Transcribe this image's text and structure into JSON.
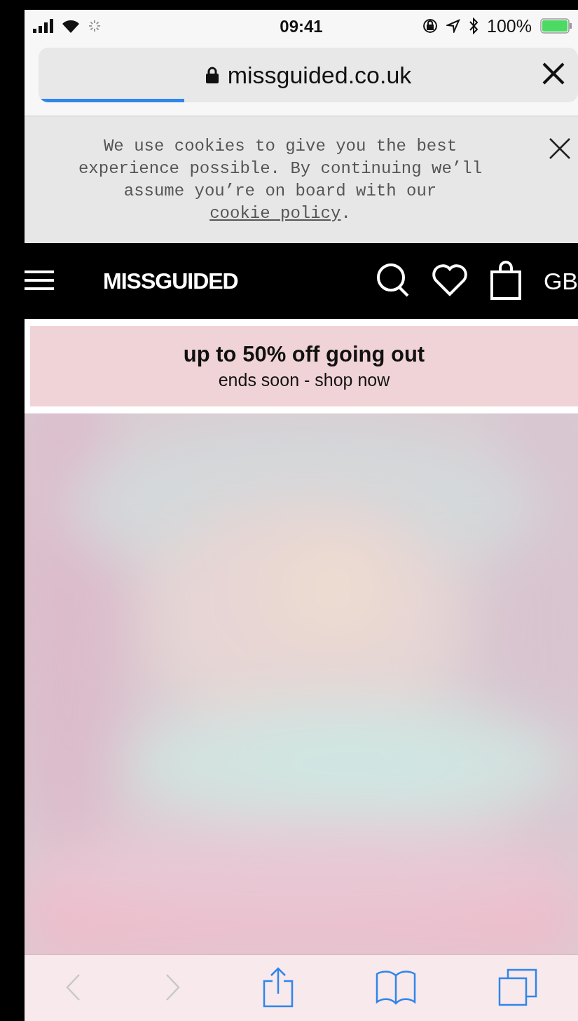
{
  "status_bar": {
    "time": "09:41",
    "battery": "100%"
  },
  "address_bar": {
    "url": "missguided.co.uk",
    "level": 0.27
  },
  "cookie_banner": {
    "text": "We use cookies to give you the best experience possible. By continuing we’ll assume you’re on board with our ",
    "link": "cookie policy",
    "end": "."
  },
  "site_header": {
    "logo": "MISSGUIDED",
    "region": "GB"
  },
  "promo": {
    "title": "up to 50% off going out",
    "subtitle": "ends soon - shop now"
  },
  "toolbar": {
    "back_disabled": true,
    "forward_disabled": true
  }
}
